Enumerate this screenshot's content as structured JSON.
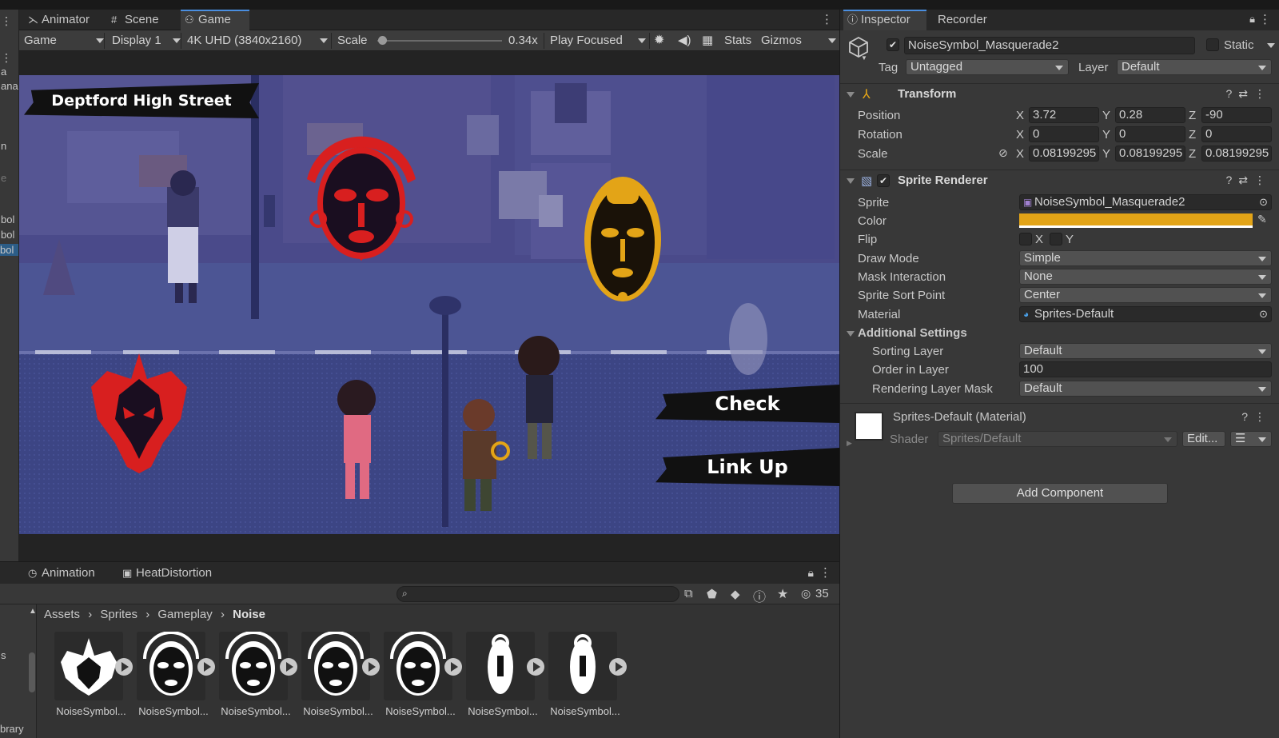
{
  "left_fragments": [
    "a",
    "ana",
    "n",
    "e",
    "bol",
    "bol",
    "bol"
  ],
  "game_tabs": [
    {
      "label": "Animator",
      "icon": "animator-icon"
    },
    {
      "label": "Scene",
      "icon": "scene-icon"
    },
    {
      "label": "Game",
      "icon": "game-icon"
    }
  ],
  "game_toolbar": {
    "view": "Game",
    "display": "Display 1",
    "resolution": "4K UHD (3840x2160)",
    "scale_label": "Scale",
    "scale_value": "0.34x",
    "scale_fraction": 0.02,
    "play_mode": "Play Focused",
    "stats": "Stats",
    "gizmos": "Gizmos"
  },
  "scene": {
    "location": "Deptford High Street",
    "button_check": "Check",
    "button_linkup": "Link Up",
    "colors": {
      "red": "#d81f1f",
      "gold": "#e3a417",
      "bg": "#3c4584"
    }
  },
  "bottom_tabs": [
    {
      "label": "Animation",
      "icon": "animation-icon"
    },
    {
      "label": "HeatDistortion",
      "icon": "component-icon"
    }
  ],
  "bottom_toolbar": {
    "search_placeholder": "",
    "hidden_count": "35"
  },
  "breadcrumb": [
    "Assets",
    "Sprites",
    "Gameplay",
    "Noise"
  ],
  "project_side": {
    "frag1": "s",
    "frag2": "brary"
  },
  "assets": [
    {
      "label": "NoiseSymbol..."
    },
    {
      "label": "NoiseSymbol..."
    },
    {
      "label": "NoiseSymbol..."
    },
    {
      "label": "NoiseSymbol..."
    },
    {
      "label": "NoiseSymbol..."
    },
    {
      "label": "NoiseSymbol..."
    },
    {
      "label": "NoiseSymbol..."
    }
  ],
  "inspector_tabs": [
    {
      "label": "Inspector",
      "icon": "info-icon"
    },
    {
      "label": "Recorder",
      "icon": ""
    }
  ],
  "inspector": {
    "object_name": "NoiseSymbol_Masquerade2",
    "static_label": "Static",
    "tag_label": "Tag",
    "tag_value": "Untagged",
    "layer_label": "Layer",
    "layer_value": "Default",
    "transform": {
      "title": "Transform",
      "position_label": "Position",
      "rotation_label": "Rotation",
      "scale_label": "Scale",
      "position": {
        "x": "3.72",
        "y": "0.28",
        "z": "-90"
      },
      "rotation": {
        "x": "0",
        "y": "0",
        "z": "0"
      },
      "scale": {
        "x": "0.08199295",
        "y": "0.08199295",
        "z": "0.08199295"
      }
    },
    "sprite_renderer": {
      "title": "Sprite Renderer",
      "sprite_label": "Sprite",
      "sprite_value": "NoiseSymbol_Masquerade2",
      "color_label": "Color",
      "color_value": "#e3a417",
      "flip_label": "Flip",
      "flip_x": "X",
      "flip_y": "Y",
      "draw_mode_label": "Draw Mode",
      "draw_mode_value": "Simple",
      "mask_label": "Mask Interaction",
      "mask_value": "None",
      "sort_point_label": "Sprite Sort Point",
      "sort_point_value": "Center",
      "material_label": "Material",
      "material_value": "Sprites-Default",
      "additional_title": "Additional Settings",
      "sorting_layer_label": "Sorting Layer",
      "sorting_layer_value": "Default",
      "order_label": "Order in Layer",
      "order_value": "100",
      "render_mask_label": "Rendering Layer Mask",
      "render_mask_value": "Default"
    },
    "material": {
      "title": "Sprites-Default (Material)",
      "shader_label": "Shader",
      "shader_value": "Sprites/Default",
      "edit_label": "Edit..."
    },
    "add_component": "Add Component"
  }
}
